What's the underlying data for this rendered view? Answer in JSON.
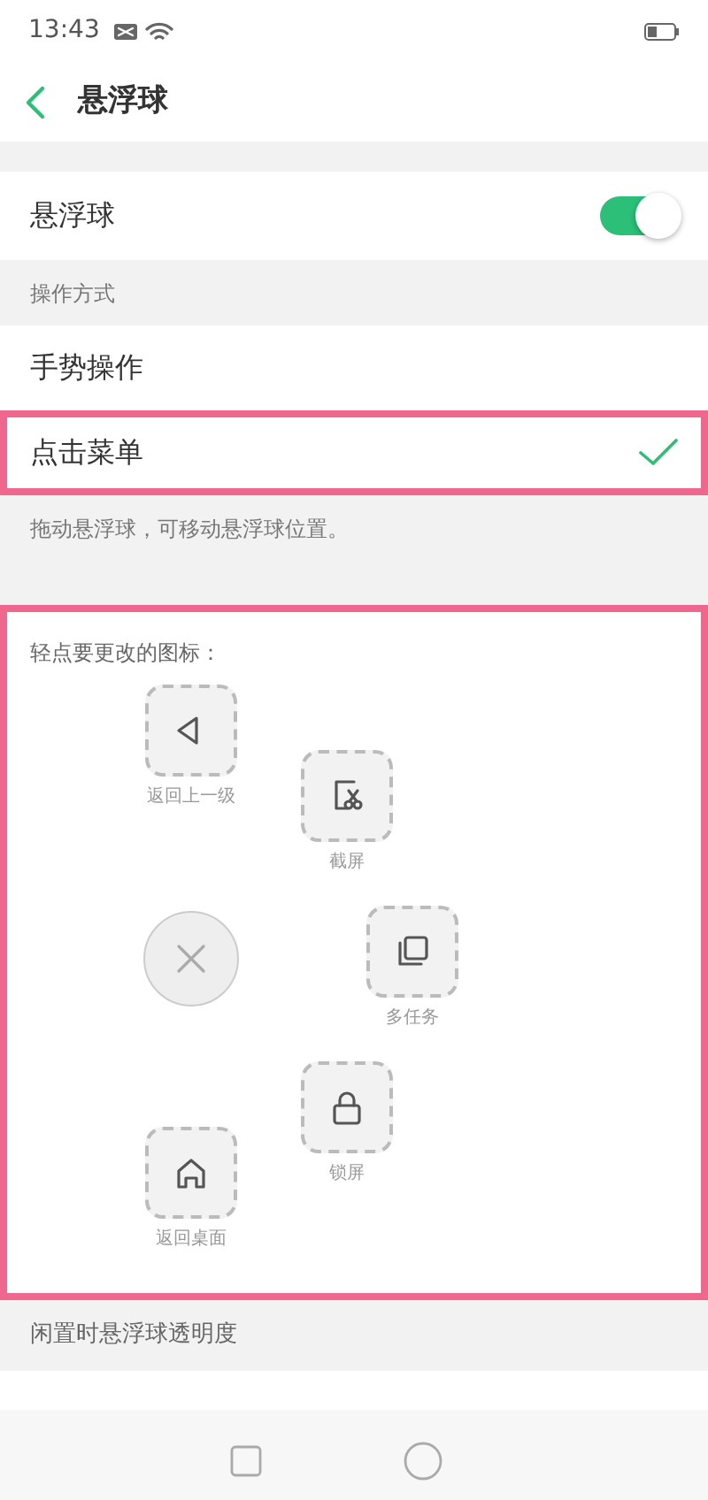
{
  "status_bar": {
    "time": "13:43"
  },
  "header": {
    "title": "悬浮球"
  },
  "main_toggle": {
    "label": "悬浮球",
    "on": true
  },
  "mode_section": {
    "title": "操作方式",
    "options": [
      {
        "label": "手势操作",
        "selected": false,
        "highlighted": false
      },
      {
        "label": "点击菜单",
        "selected": true,
        "highlighted": true
      }
    ],
    "hint": "拖动悬浮球，可移动悬浮球位置。"
  },
  "icon_panel": {
    "title": "轻点要更改的图标：",
    "highlighted": true,
    "items": [
      {
        "kind": "back",
        "label": "返回上一级"
      },
      {
        "kind": "screenshot",
        "label": "截屏"
      },
      {
        "kind": "close"
      },
      {
        "kind": "multitask",
        "label": "多任务"
      },
      {
        "kind": "lock",
        "label": "锁屏"
      },
      {
        "kind": "home",
        "label": "返回桌面"
      }
    ]
  },
  "opacity_section": {
    "title": "闲置时悬浮球透明度"
  },
  "nav_bar": {
    "buttons": [
      {
        "kind": "recents"
      },
      {
        "kind": "home"
      }
    ]
  }
}
